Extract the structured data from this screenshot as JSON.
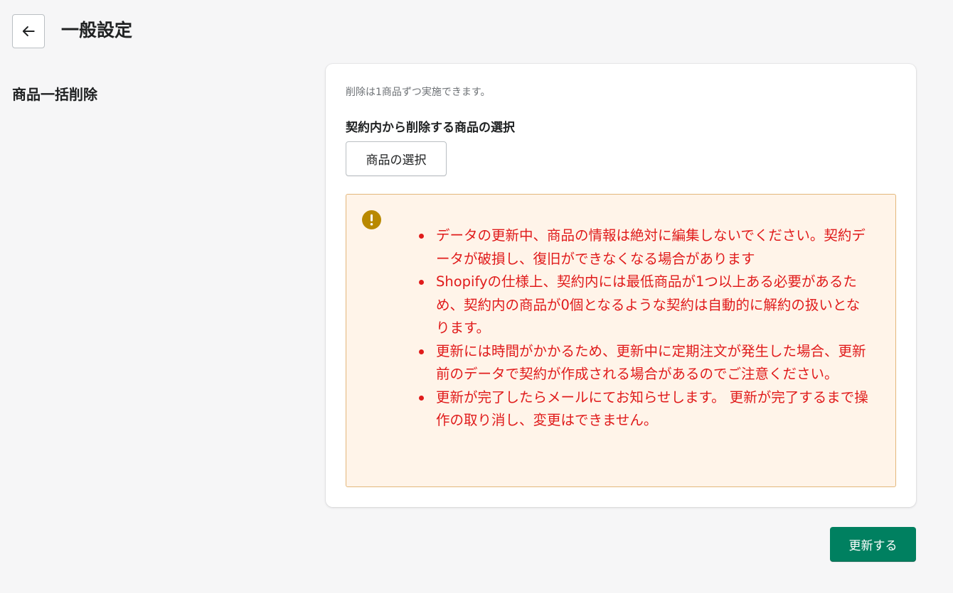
{
  "header": {
    "back_icon": "arrow-left-icon",
    "title": "一般設定"
  },
  "section": {
    "title": "商品一括削除"
  },
  "card": {
    "note": "削除は1商品ずつ実施できます。",
    "field_label": "契約内から削除する商品の選択",
    "select_button": "商品の選択"
  },
  "warning": {
    "icon": "exclamation-circle-icon",
    "icon_color": "#b98900",
    "text_color": "#e01b1b",
    "background": "#fff4e9",
    "items": [
      "データの更新中、商品の情報は絶対に編集しないでください。契約データが破損し、復旧ができなくなる場合があります",
      "Shopifyの仕様上、契約内には最低商品が1つ以上ある必要があるため、契約内の商品が0個となるような契約は自動的に解約の扱いとなります。",
      "更新には時間がかかるため、更新中に定期注文が発生した場合、更新前のデータで契約が作成される場合があるのでご注意ください。",
      "更新が完了したらメールにてお知らせします。 更新が完了するまで操作の取り消し、変更はできません。"
    ]
  },
  "actions": {
    "update_button": "更新する",
    "primary_color": "#008060"
  }
}
